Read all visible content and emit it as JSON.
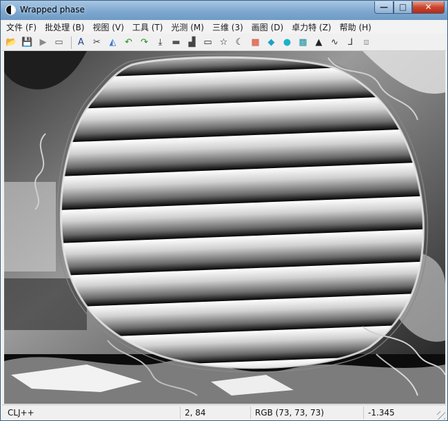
{
  "window": {
    "title": "Wrapped phase",
    "controls": {
      "minimize": "—",
      "maximize": "□",
      "close": "✕"
    }
  },
  "menu": [
    {
      "label": "文件 (F)"
    },
    {
      "label": "批处理 (B)"
    },
    {
      "label": "视图 (V)"
    },
    {
      "label": "工具 (T)"
    },
    {
      "label": "光测 (M)"
    },
    {
      "label": "三维 (3)"
    },
    {
      "label": "画图 (D)"
    },
    {
      "label": "卓力特 (Z)"
    },
    {
      "label": "帮助 (H)"
    }
  ],
  "toolbar": [
    {
      "name": "open-folder-icon",
      "glyph": "📂",
      "color": "#c89a2a"
    },
    {
      "name": "save-disk-icon",
      "glyph": "💾",
      "color": "#2b4f8a"
    },
    {
      "name": "play-icon",
      "glyph": "▶",
      "color": "#8a8a8a"
    },
    {
      "name": "layout-icon",
      "glyph": "▭",
      "color": "#555555"
    },
    {
      "sep": true
    },
    {
      "name": "text-tool-icon",
      "glyph": "A",
      "color": "#1b3f8a"
    },
    {
      "name": "scissors-icon",
      "glyph": "✂",
      "color": "#444444"
    },
    {
      "name": "shapes-icon",
      "glyph": "◭",
      "color": "#3a7bd5"
    },
    {
      "name": "undo-icon",
      "glyph": "↶",
      "color": "#1f8f1f"
    },
    {
      "name": "redo-icon",
      "glyph": "↷",
      "color": "#1f8f1f"
    },
    {
      "name": "download-icon",
      "glyph": "⤓",
      "color": "#222222"
    },
    {
      "name": "ruler-icon",
      "glyph": "▬",
      "color": "#555555"
    },
    {
      "name": "bar-levels-icon",
      "glyph": "▟",
      "color": "#444444"
    },
    {
      "name": "rectangle-icon",
      "glyph": "▭",
      "color": "#222222"
    },
    {
      "name": "star-icon",
      "glyph": "☆",
      "color": "#222222"
    },
    {
      "name": "crescent-icon",
      "glyph": "☾",
      "color": "#222222"
    },
    {
      "name": "colormap-icon",
      "glyph": "▦",
      "color": "#d4381c"
    },
    {
      "name": "diamond-icon",
      "glyph": "◆",
      "color": "#1aa3c7"
    },
    {
      "name": "circle-icon",
      "glyph": "●",
      "color": "#17b3c9"
    },
    {
      "name": "scatter-icon",
      "glyph": "▩",
      "color": "#1a8f9f"
    },
    {
      "name": "histogram-icon",
      "glyph": "▲",
      "color": "#222222"
    },
    {
      "name": "waveform-icon",
      "glyph": "∿",
      "color": "#333333"
    },
    {
      "name": "axes-icon",
      "glyph": "⅃",
      "color": "#333333"
    },
    {
      "name": "cube-icon",
      "glyph": "⧈",
      "color": "#9a9a9a"
    }
  ],
  "status": {
    "app": "CLJ++",
    "coords": "2, 84",
    "rgb": "RGB (73, 73, 73)",
    "value": "-1.345"
  }
}
